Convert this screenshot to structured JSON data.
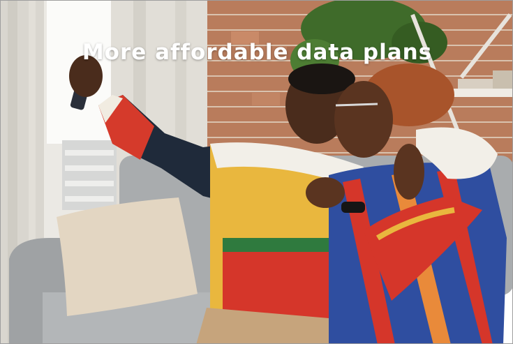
{
  "banner": {
    "headline": "More affordable data plans"
  },
  "scene": {
    "subject": "couple-taking-selfie-on-sofa-photo",
    "colors": {
      "wall": "#e8e6e1",
      "brick": "#b97c5c",
      "sofa": "#a9acae",
      "sweater_yellow": "#e9b73e",
      "sweater_red": "#d5362a",
      "sweater_green": "#2f7a3e",
      "shirt_blue": "#2f4ea0",
      "plant": "#3f6b2a"
    }
  }
}
